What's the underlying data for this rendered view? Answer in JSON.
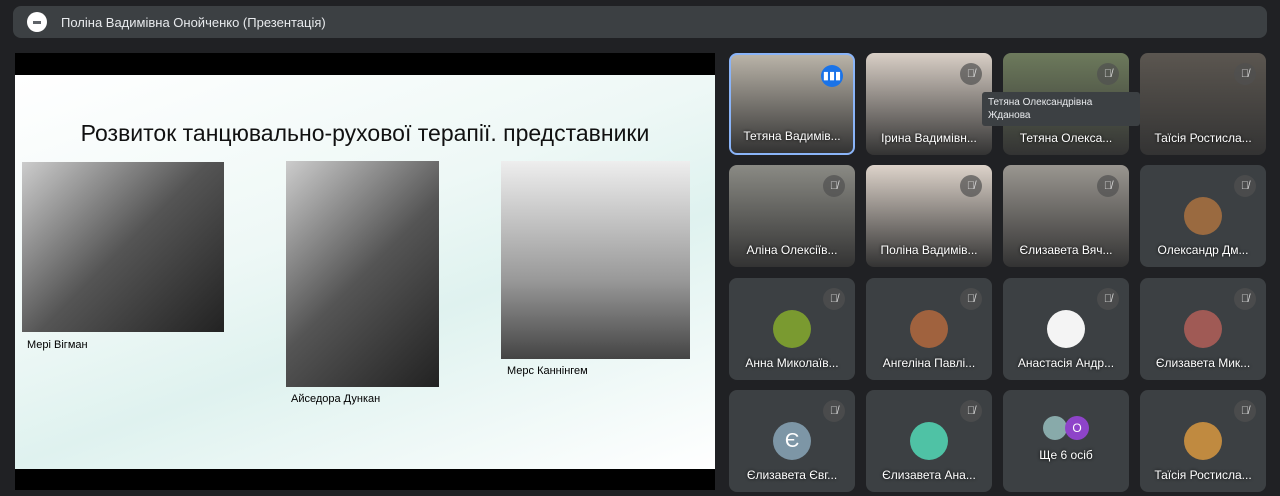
{
  "header": {
    "title": "Поліна Вадимівна Онойченко (Презентація)"
  },
  "slide": {
    "title": "Розвиток танцювально-рухової терапії. представники",
    "captions": [
      "Мері Вігман",
      "Айседора Дункан",
      "Мерс Каннінгем"
    ]
  },
  "tooltip": {
    "line1": "Тетяна Олександрівна",
    "line2": "Жданова"
  },
  "participants": [
    {
      "name": "Тетяна Вадимів..."
    },
    {
      "name": "Ірина Вадимівн..."
    },
    {
      "name": "Тетяна Олекса..."
    },
    {
      "name": "Таїсія Ростисла..."
    },
    {
      "name": "Аліна Олексіїв..."
    },
    {
      "name": "Поліна Вадимів..."
    },
    {
      "name": "Єлизавета Вяч..."
    },
    {
      "name": "Олександр Дм..."
    },
    {
      "name": "Анна Миколаїв..."
    },
    {
      "name": "Ангеліна Павлі..."
    },
    {
      "name": "Анастасія Андр..."
    },
    {
      "name": "Єлизавета Мик..."
    },
    {
      "name": "Єлизавета Євг...",
      "initial": "Є"
    },
    {
      "name": "Єлизавета Ана..."
    },
    {
      "name": "Ще 6 осіб",
      "initial": "О"
    },
    {
      "name": "Таїсія Ростисла..."
    }
  ],
  "colors": {
    "accent": "#1a73e8",
    "bg": "#202124",
    "tile": "#3c4043"
  }
}
